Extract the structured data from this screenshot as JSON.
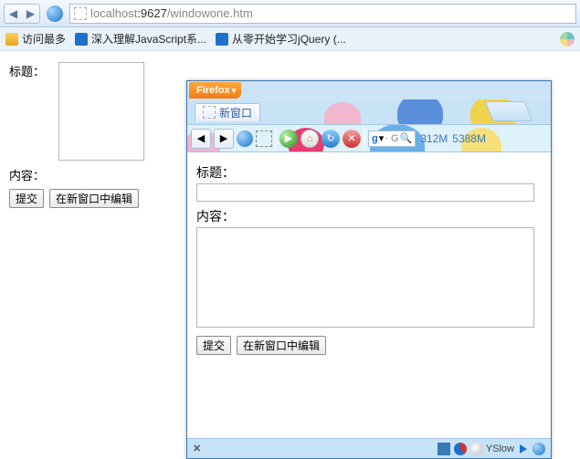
{
  "outer_nav": {
    "back_glyph": "◀",
    "fwd_glyph": "▶",
    "url_host": "localhost",
    "url_port": ":9627",
    "url_path": "/windowone.htm"
  },
  "outer_bookmarks": {
    "visit_more": "访问最多",
    "bm1": "深入理解JavaScript系...",
    "bm2": "从零开始学习jQuery (..."
  },
  "outer_form": {
    "title_label": "标题：",
    "content_label": "内容：",
    "submit": "提交",
    "open_edit": "在新窗口中编辑"
  },
  "inner_win": {
    "ff_label": "Firefox",
    "ff_tri": "▾",
    "tab_label": "新窗口",
    "tool_back": "◀",
    "tool_fwd": "▶",
    "home_glyph": "⌂",
    "reload_glyph": "↻",
    "stop_glyph": "✕",
    "google_g": "g",
    "google_tri": "▾",
    "google_hint": "· G",
    "google_search": "🔍",
    "mem1": "312M",
    "mem2": "5388M",
    "form": {
      "title_label": "标题：",
      "content_label": "内容：",
      "submit": "提交",
      "open_edit": "在新窗口中编辑"
    },
    "status": {
      "close": "✕",
      "yslow": "YSlow"
    }
  }
}
